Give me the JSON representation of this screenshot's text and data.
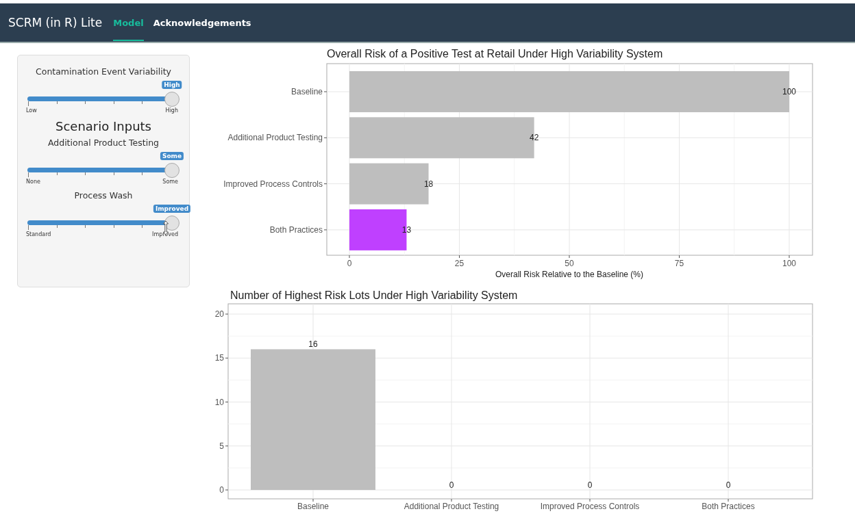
{
  "navbar": {
    "brand": "SCRM (in R) Lite",
    "tabs": [
      {
        "label": "Model",
        "selected": true
      },
      {
        "label": "Acknowledgements",
        "selected": false
      }
    ]
  },
  "sidebar": {
    "sliders": [
      {
        "label": "Contamination Event Variability",
        "value": "High",
        "min_label": "Low",
        "max_label": "High",
        "level": 1
      },
      {
        "heading": "Scenario Inputs",
        "label": "Additional Product Testing",
        "value": "Some",
        "min_label": "None",
        "max_label": "Some",
        "level": 1
      },
      {
        "label": "Process Wash",
        "value": "Improved",
        "min_label": "Standard",
        "max_label": "Improved",
        "level": 1,
        "cursor": true
      }
    ]
  },
  "charts": [
    {
      "chart_data": {
        "type": "bar",
        "orientation": "horizontal",
        "title": "Overall Risk of a Positive Test at Retail Under High Variability System",
        "xlabel": "Overall Risk Relative to the Baseline (%)",
        "categories": [
          "Baseline",
          "Additional Product Testing",
          "Improved Process Controls",
          "Both Practices"
        ],
        "values": [
          100,
          42,
          18,
          13
        ],
        "colors": [
          "#bebebe",
          "#bebebe",
          "#bebebe",
          "#bf40ff"
        ],
        "xlim": [
          0,
          100
        ],
        "xticks": [
          0,
          25,
          50,
          75,
          100
        ],
        "grid": true,
        "data_labels": true
      }
    },
    {
      "chart_data": {
        "type": "bar",
        "orientation": "vertical",
        "title": "Number of Highest Risk Lots Under High Variability System",
        "categories": [
          "Baseline",
          "Additional Product Testing",
          "Improved Process Controls",
          "Both Practices"
        ],
        "values": [
          16,
          0,
          0,
          0
        ],
        "colors": [
          "#bebebe",
          "#bebebe",
          "#bebebe",
          "#bebebe"
        ],
        "ylim": [
          0,
          20
        ],
        "yticks": [
          0,
          5,
          10,
          15,
          20
        ],
        "grid": true,
        "data_labels": true
      }
    }
  ]
}
